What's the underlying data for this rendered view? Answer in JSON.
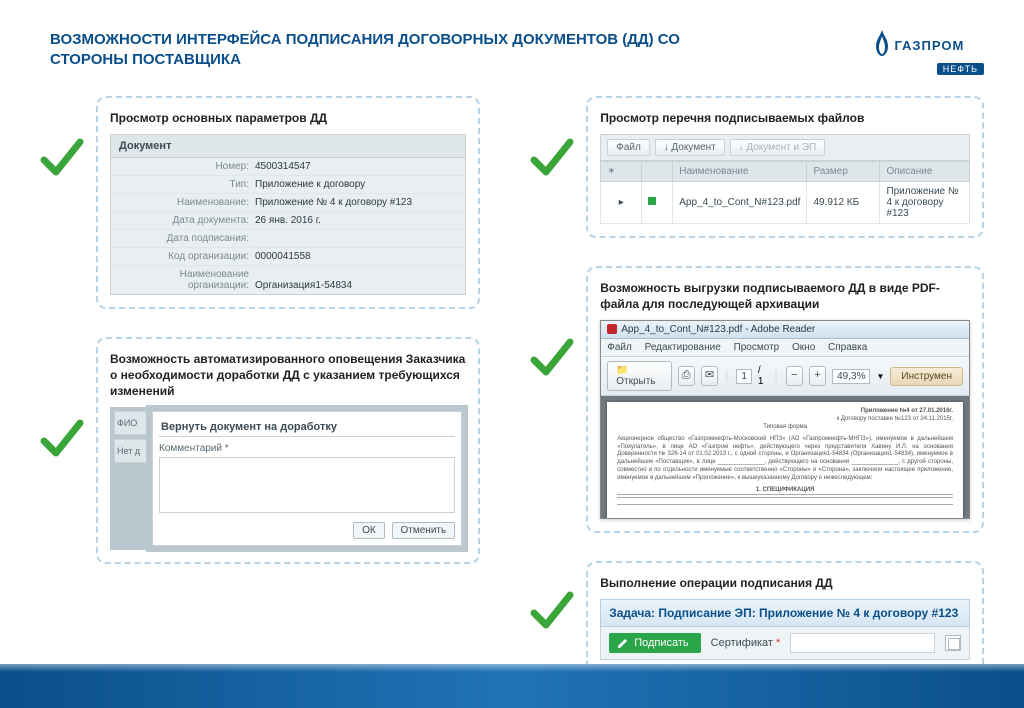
{
  "brand": {
    "name": "ГАЗПРОМ",
    "sub": "НЕФТЬ"
  },
  "title": "ВОЗМОЖНОСТИ ИНТЕРФЕЙСА ПОДПИСАНИЯ ДОГОВОРНЫХ ДОКУМЕНТОВ (ДД) СО СТОРОНЫ ПОСТАВЩИКА",
  "left": {
    "params": {
      "caption": "Просмотр основных параметров ДД",
      "header": "Документ",
      "rows": {
        "num_l": "Номер:",
        "num_v": "4500314547",
        "type_l": "Тип:",
        "type_v": "Приложение к договору",
        "name_l": "Наименование:",
        "name_v": "Приложение № 4 к договору #123",
        "date_l": "Дата документа:",
        "date_v": "26 янв. 2016 г.",
        "sign_l": "Дата подписания:",
        "sign_v": "",
        "org_l": "Код организации:",
        "org_v": "0000041558",
        "orgn_l": "Наименование организации:",
        "orgn_v": "Организация1-54834"
      }
    },
    "rework": {
      "caption": "Возможность автоматизированного оповещения Заказчика о необходимости доработки ДД с указанием требующихся изменений",
      "dialog_title": "Вернуть документ на доработку",
      "comment_label": "Комментарий *",
      "ok": "ОК",
      "cancel": "Отменить",
      "side_labels": {
        "a": "ФИО",
        "b": "Нет д"
      }
    }
  },
  "right": {
    "files": {
      "caption": "Просмотр перечня подписываемых файлов",
      "tabs": {
        "file": "Файл",
        "doc": "Документ",
        "docsp": "Документ и ЭП"
      },
      "cols": {
        "name": "Наименование",
        "size": "Размер",
        "desc": "Описание"
      },
      "row": {
        "name": "App_4_to_Cont_N#123.pdf",
        "size": "49,912 КБ",
        "desc": "Приложение № 4 к договору #123"
      }
    },
    "pdf": {
      "caption": "Возможность выгрузки подписываемого ДД в виде PDF-файла для последующей архивации",
      "titlebar": "App_4_to_Cont_N#123.pdf - Adobe Reader",
      "menus": {
        "file": "Файл",
        "edit": "Редактирование",
        "view": "Просмотр",
        "window": "Окно",
        "help": "Справка"
      },
      "toolbar": {
        "open": "Открыть",
        "page": "1",
        "of": "/ 1",
        "zoom": "49,3%",
        "instr": "Инструмен"
      },
      "doc": {
        "app_line1": "Приложение №4 от 27.01.2016г.",
        "app_line2": "к Договору поставки №123 от 24.11.2015г.",
        "form": "Типовая форма",
        "body": "Акционерное общество «Газпромнефть-Московский НПЗ» (АО «Газпромнефть-МНПЗ»), именуемое в дальнейшем «Покупатель», в лице АО «Газпром нефть», действующего через представителя Хавину И.Л. на основании Доверенности № 326-14 от 01.02.2013 г., с одной стороны, и Организация1-54834 (Организация1-54834), именуемое в дальнейшем «Поставщик», в лице ______________, действующего на основании ______________, с другой стороны, совместно и по отдельности именуемые соответственно «Стороны» и «Сторона», заключили настоящее приложение, именуемое в дальнейшем «Приложение», к вышеуказанному Договору о нижеследующем:",
        "spec": "1. СПЕЦИФИКАЦИЯ"
      }
    },
    "sign": {
      "caption": "Выполнение операции подписания ДД",
      "task": "Задача: Подписание ЭП: Приложение № 4 к договору #123",
      "btn": "Подписать",
      "cert_label": "Сертификат"
    }
  }
}
